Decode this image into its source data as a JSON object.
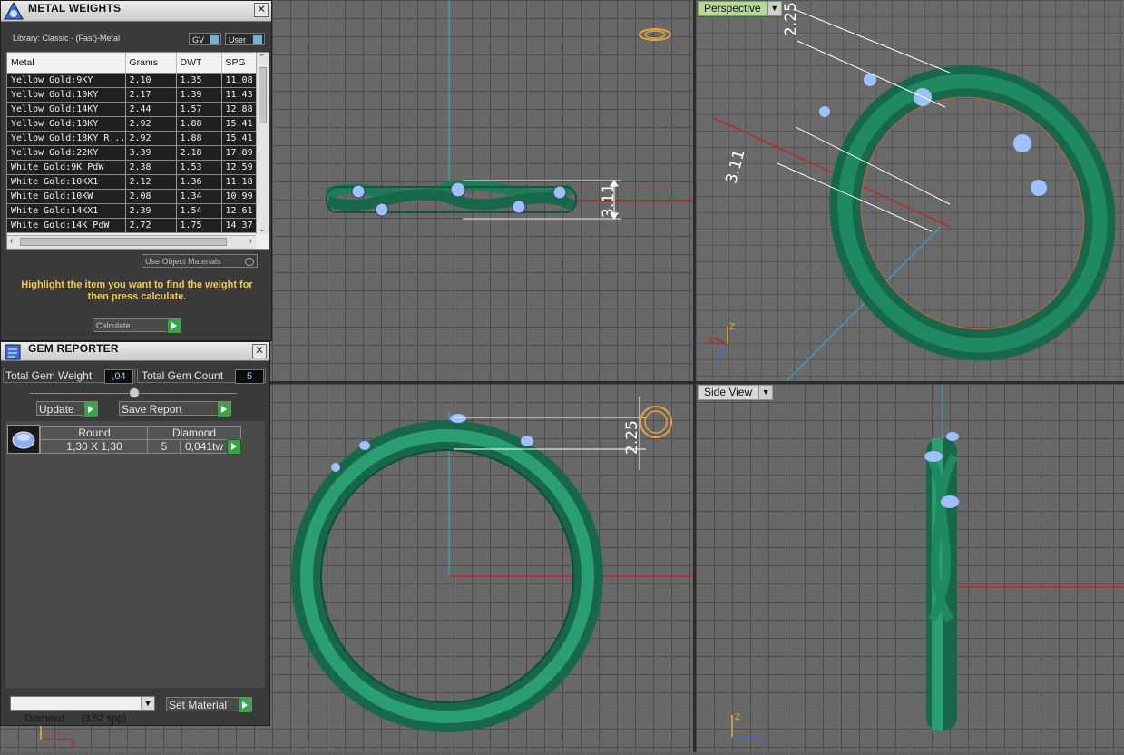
{
  "viewports": {
    "top": {
      "dimension": "3.11"
    },
    "perspective": {
      "label": "Perspective",
      "dimension_a": "2.25",
      "dimension_b": "3.11"
    },
    "front": {
      "dimension": "2.25"
    },
    "side": {
      "label": "Side View"
    }
  },
  "metal_weights": {
    "title": "METAL WEIGHTS",
    "library": "Library: Classic - (Fast)-Metal",
    "gv_label": "GV",
    "user_label": "User",
    "columns": [
      "Metal",
      "Grams",
      "DWT",
      "SPG"
    ],
    "rows": [
      [
        "Yellow Gold:9KY",
        "2.10",
        "1.35",
        "11.08"
      ],
      [
        "Yellow Gold:10KY",
        "2.17",
        "1.39",
        "11.43"
      ],
      [
        "Yellow Gold:14KY",
        "2.44",
        "1.57",
        "12.88"
      ],
      [
        "Yellow Gold:18KY",
        "2.92",
        "1.88",
        "15.41"
      ],
      [
        "Yellow Gold:18KY R...",
        "2.92",
        "1.88",
        "15.41"
      ],
      [
        "Yellow Gold:22KY",
        "3.39",
        "2.18",
        "17.89"
      ],
      [
        "White Gold:9K PdW",
        "2.38",
        "1.53",
        "12.59"
      ],
      [
        "White Gold:10KX1",
        "2.12",
        "1.36",
        "11.18"
      ],
      [
        "White Gold:10KW",
        "2.08",
        "1.34",
        "10.99"
      ],
      [
        "White Gold:14KX1",
        "2.39",
        "1.54",
        "12.61"
      ],
      [
        "White Gold:14K PdW",
        "2.72",
        "1.75",
        "14.37"
      ]
    ],
    "use_object_materials": "Use Object Materials",
    "instruction": "Highlight the item you want to find the weight for then press calculate.",
    "calculate": "Calculate"
  },
  "gem_reporter": {
    "title": "GEM REPORTER",
    "total_weight_label": "Total Gem Weight",
    "total_weight_value": ",04",
    "total_count_label": "Total Gem Count",
    "total_count_value": "5",
    "update": "Update",
    "save_report": "Save Report",
    "gem": {
      "shape": "Round",
      "material": "Diamond",
      "size": "1,30 X 1,30",
      "count": "5",
      "weight": "0,041tw"
    },
    "material_select": "Diamond      (3,52 spg)",
    "set_material": "Set Material"
  },
  "colors": {
    "ring": "#1f8a62",
    "gem": "#9fc0ff",
    "accent_green": "#3aa34a",
    "instruction": "#f2c94c"
  }
}
